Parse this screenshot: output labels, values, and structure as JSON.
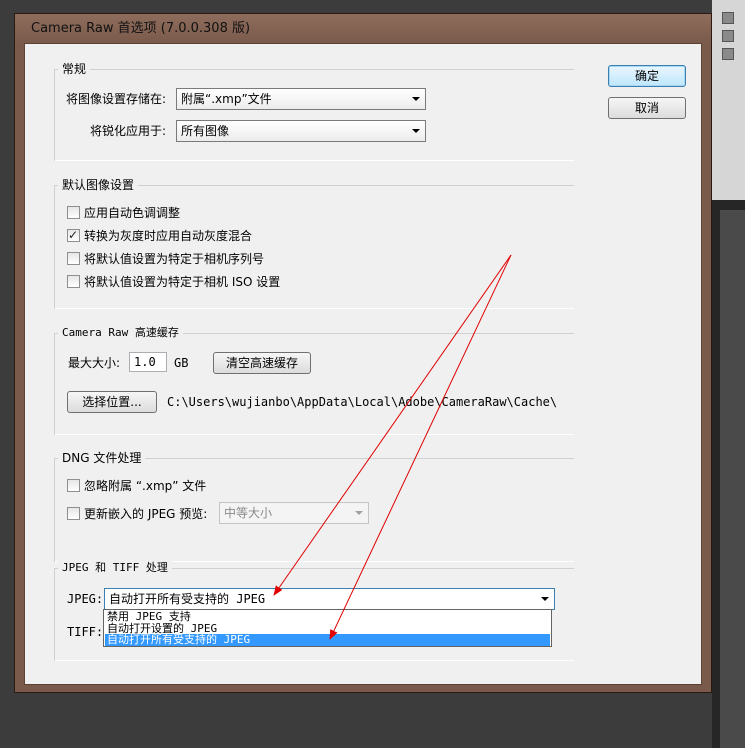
{
  "dialog": {
    "title": "Camera Raw 首选项 (7.0.0.308 版)",
    "ok_label": "确定",
    "cancel_label": "取消"
  },
  "general": {
    "legend": "常规",
    "save_label": "将图像设置存储在:",
    "save_value": "附属“.xmp”文件",
    "sharpen_label": "将锐化应用于:",
    "sharpen_value": "所有图像"
  },
  "defaults": {
    "legend": "默认图像设置",
    "items": [
      {
        "label": "应用自动色调调整",
        "checked": false
      },
      {
        "label": "转换为灰度时应用自动灰度混合",
        "checked": true
      },
      {
        "label": "将默认值设置为特定于相机序列号",
        "checked": false
      },
      {
        "label": "将默认值设置为特定于相机 ISO 设置",
        "checked": false
      }
    ]
  },
  "cache": {
    "legend": "Camera Raw 高速缓存",
    "max_label": "最大大小:",
    "max_value": "1.0",
    "unit": "GB",
    "purge_label": "清空高速缓存",
    "select_label": "选择位置...",
    "path": "C:\\Users\\wujianbo\\AppData\\Local\\Adobe\\CameraRaw\\Cache\\"
  },
  "dng": {
    "legend": "DNG 文件处理",
    "ignore_label": "忽略附属 “.xmp” 文件",
    "ignore_checked": false,
    "update_label": "更新嵌入的 JPEG 预览:",
    "update_checked": false,
    "update_value": "中等大小"
  },
  "jpeg_tiff": {
    "legend": "JPEG 和 TIFF 处理",
    "jpeg_label": "JPEG:",
    "jpeg_value": "自动打开所有受支持的 JPEG",
    "tiff_label": "TIFF:",
    "options": [
      "禁用 JPEG 支持",
      "自动打开设置的 JPEG",
      "自动打开所有受支持的 JPEG"
    ],
    "selected_index": 2
  },
  "colors": {
    "frame": "#7a5a4b",
    "client": "#f0f0f0",
    "highlight": "#3399ff",
    "annotation_arrow": "#e00000"
  }
}
